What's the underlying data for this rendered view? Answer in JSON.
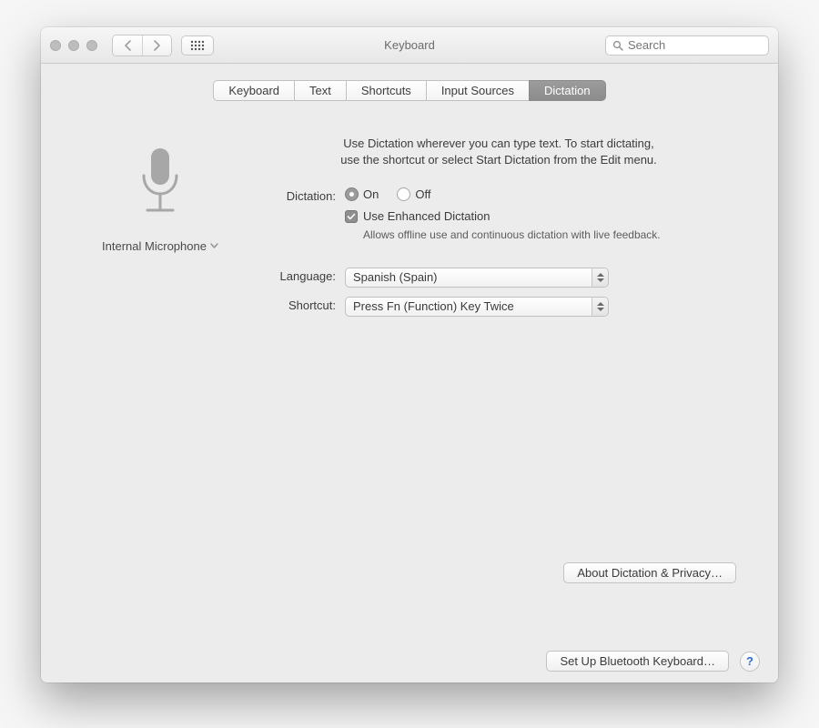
{
  "window": {
    "title": "Keyboard"
  },
  "search": {
    "placeholder": "Search"
  },
  "tabs": [
    "Keyboard",
    "Text",
    "Shortcuts",
    "Input Sources",
    "Dictation"
  ],
  "active_tab_index": 4,
  "mic": {
    "label": "Internal Microphone"
  },
  "intro": {
    "line1": "Use Dictation wherever you can type text. To start dictating,",
    "line2": "use the shortcut or select Start Dictation from the Edit menu."
  },
  "dictation": {
    "label": "Dictation:",
    "on_label": "On",
    "off_label": "Off",
    "selected": "On",
    "enhanced_label": "Use Enhanced Dictation",
    "enhanced_checked": true,
    "enhanced_desc": "Allows offline use and continuous dictation with live feedback."
  },
  "language": {
    "label": "Language:",
    "value": "Spanish (Spain)"
  },
  "shortcut": {
    "label": "Shortcut:",
    "value": "Press Fn (Function) Key Twice"
  },
  "about_button": "About Dictation & Privacy…",
  "bluetooth_button": "Set Up Bluetooth Keyboard…",
  "help_label": "?"
}
